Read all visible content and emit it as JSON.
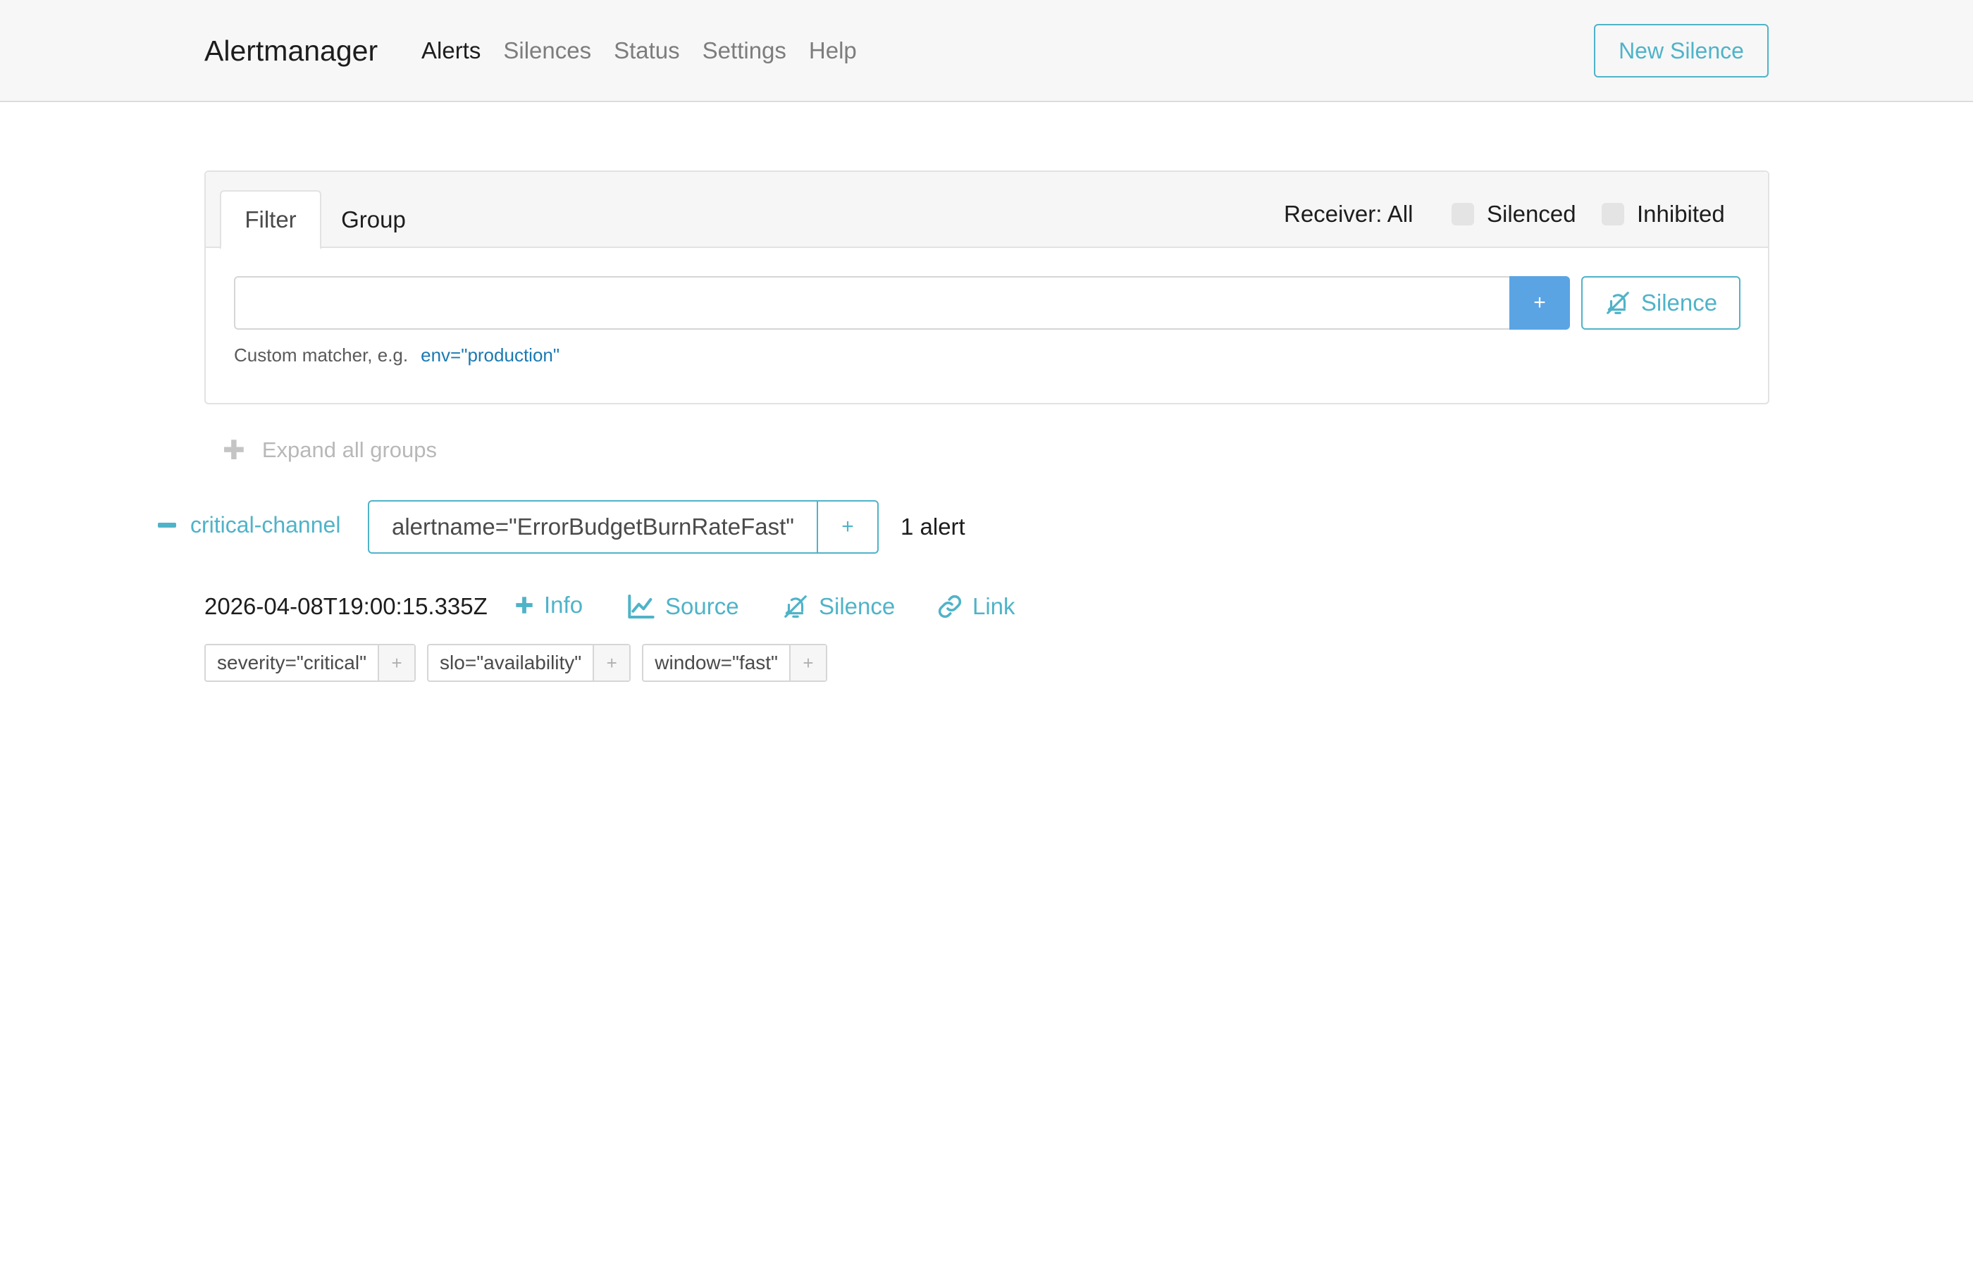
{
  "navbar": {
    "brand": "Alertmanager",
    "links": [
      {
        "label": "Alerts",
        "active": true
      },
      {
        "label": "Silences",
        "active": false
      },
      {
        "label": "Status",
        "active": false
      },
      {
        "label": "Settings",
        "active": false
      },
      {
        "label": "Help",
        "active": false
      }
    ],
    "new_silence_label": "New Silence"
  },
  "filter_card": {
    "tabs": [
      {
        "label": "Filter",
        "active": true
      },
      {
        "label": "Group",
        "active": false
      }
    ],
    "receiver_label": "Receiver: All",
    "silenced_label": "Silenced",
    "silenced_checked": false,
    "inhibited_label": "Inhibited",
    "inhibited_checked": false,
    "input_value": "",
    "add_button_label": "+",
    "silence_button_label": "Silence",
    "helper_text": "Custom matcher, e.g.",
    "helper_example": "env=\"production\""
  },
  "expand_all_label": "Expand all groups",
  "group": {
    "receiver": "critical-channel",
    "label": "alertname=\"ErrorBudgetBurnRateFast\"",
    "label_add": "+",
    "count_text": "1 alert"
  },
  "alert": {
    "starts_at": "2026-04-08T19:00:15.335Z",
    "actions": {
      "info": "Info",
      "source": "Source",
      "silence": "Silence",
      "link": "Link"
    },
    "labels": [
      {
        "text": "severity=\"critical\"",
        "add": "+"
      },
      {
        "text": "slo=\"availability\"",
        "add": "+"
      },
      {
        "text": "window=\"fast\"",
        "add": "+"
      }
    ]
  },
  "colors": {
    "accent": "#4fb3c8",
    "primary_button": "#5aa4e4",
    "navbar_bg": "#f7f7f7",
    "helper_link": "#1a79b3"
  },
  "icons": [
    "plus-icon",
    "chart-line-icon",
    "bell-slash-icon",
    "link-icon",
    "minus-icon"
  ]
}
